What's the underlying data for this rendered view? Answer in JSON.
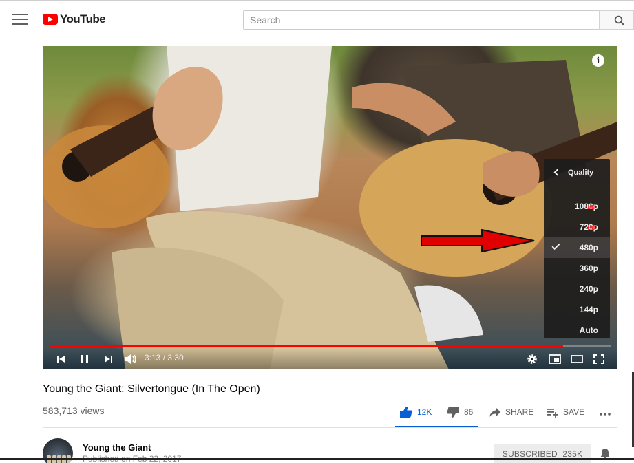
{
  "header": {
    "logo_text": "YouTube",
    "search_placeholder": "Search"
  },
  "player": {
    "info_label": "i",
    "time_display": "3:13 / 3:30",
    "progress_fraction": 0.915,
    "quality_menu": {
      "title": "Quality",
      "options": [
        {
          "label": "1080p",
          "badge": "HD",
          "selected": false
        },
        {
          "label": "720p",
          "badge": "HD",
          "selected": false
        },
        {
          "label": "480p",
          "badge": "",
          "selected": true
        },
        {
          "label": "360p",
          "badge": "",
          "selected": false
        },
        {
          "label": "240p",
          "badge": "",
          "selected": false
        },
        {
          "label": "144p",
          "badge": "",
          "selected": false
        },
        {
          "label": "Auto",
          "badge": "",
          "selected": false
        }
      ]
    }
  },
  "video": {
    "title": "Young the Giant: Silvertongue (In The Open)",
    "views": "583,713 views",
    "likes": "12K",
    "dislikes": "86",
    "share_label": "SHARE",
    "save_label": "SAVE"
  },
  "channel": {
    "name": "Young the Giant",
    "music_note": "♪",
    "published": "Published on Feb 22, 2017",
    "subscribe_label": "SUBSCRIBED",
    "subscriber_count": "235K"
  },
  "colors": {
    "brand_red": "#ff0000",
    "like_blue": "#065fd4",
    "menu_bg": "#1c1c1c"
  }
}
